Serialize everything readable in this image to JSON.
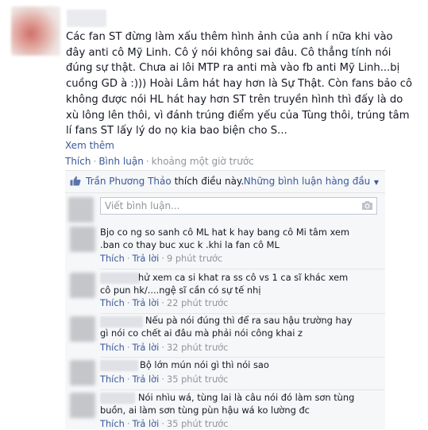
{
  "post": {
    "text": "Các fan ST đừng làm xấu thêm hình ảnh của anh í nữa khi vào đây anti cô Mỹ Linh. Cô ý nói không sai đâu. Cô thẳng tính nói đúng sự thật. Chưa ai lôi MTP ra anti mà vào fb anti Mỹ Linh...bị cuồng GD à :))) Hoài Lâm hát hay hơn là Sự Thật. Còn fans bảo cô không được nói HL hát hay hơn ST trên truyền hình thì đấy là do xù lông lên thôi, vì đánh trúng điểm yếu của Tùng thôi, trúng tâm lí fans ST lấy lý do nọ kia bao biện cho S...",
    "see_more": "Xem thêm",
    "like_label": "Thích",
    "comment_label": "Bình luận",
    "time": "khoảng một giờ trước"
  },
  "likes": {
    "liker_name": "Trần Phương Thảo",
    "likes_suffix": "thích điều này.",
    "top_comments_label": "Những bình luận hàng đầu"
  },
  "composer": {
    "placeholder": "Viết bình luận..."
  },
  "comments": [
    {
      "text": "Bjo co ng so sanh cô ML hat k hay bang cô Mi tâm xem .ban co thay buc xuc k .khi la fan cô ML",
      "like_label": "Thích",
      "reply_label": "Trả lời",
      "time": "9 phút trước"
    },
    {
      "text": "hử xem ca si khat ra ss cô vs 1 ca sĩ khác xem cô pun hk/....ngệ sĩ cần có sự tế nhị",
      "like_label": "Thích",
      "reply_label": "Trả lời",
      "time": "22 phút trước"
    },
    {
      "text": "Nếu pà nói đúng thì để ra sau hậu trường hay gì nói co chết ai đâu mà phải nói công khai z",
      "like_label": "Thích",
      "reply_label": "Trả lời",
      "time": "32 phút trước"
    },
    {
      "text": "Bộ lớn mún nói gì thì nói sao",
      "like_label": "Thích",
      "reply_label": "Trả lời",
      "time": "35 phút trước"
    },
    {
      "text": "Nói nhìu wá, tùng lai là câu nói đó làm sơn tùng buồn, ai làm sơn tùng pùn hậu wá ko lường đc",
      "like_label": "Thích",
      "reply_label": "Trả lời",
      "time": "35 phút trước"
    }
  ],
  "colors": {
    "link": "#3b5998",
    "meta": "#90949c",
    "text": "#141823",
    "feedback_bg": "#f6f7f9"
  }
}
